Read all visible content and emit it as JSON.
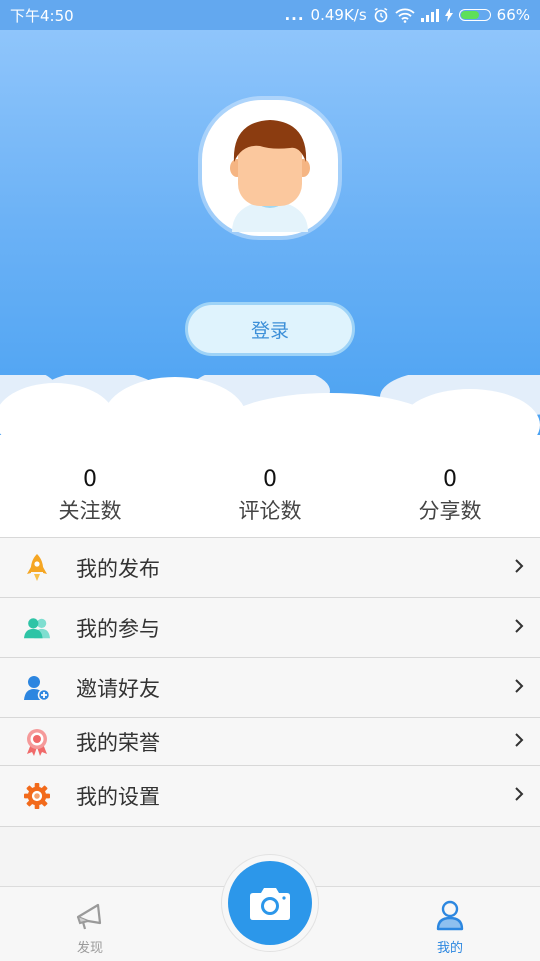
{
  "status_bar": {
    "time": "下午4:50",
    "dots": "...",
    "network_speed": "0.49K/s",
    "battery_percent": "66%",
    "battery_level": 0.66,
    "icons": [
      "alarm-icon",
      "wifi-icon",
      "signal-icon",
      "charging-icon",
      "battery-icon"
    ]
  },
  "profile": {
    "avatar": "avatar-boy",
    "login_label": "登录"
  },
  "stats": [
    {
      "value": "0",
      "label": "关注数"
    },
    {
      "value": "0",
      "label": "评论数"
    },
    {
      "value": "0",
      "label": "分享数"
    }
  ],
  "menu": [
    {
      "label": "我的发布",
      "icon": "rocket-icon",
      "color": "#f5a623"
    },
    {
      "label": "我的参与",
      "icon": "people-icon",
      "color": "#2ec4a6"
    },
    {
      "label": "邀请好友",
      "icon": "add-user-icon",
      "color": "#2d86e0"
    },
    {
      "label": "我的荣誉",
      "icon": "medal-icon",
      "color": "#f06a6a"
    },
    {
      "label": "我的设置",
      "icon": "gear-icon",
      "color": "#f26a1b"
    }
  ],
  "tabbar": {
    "discover_label": "发现",
    "mine_label": "我的",
    "camera_icon": "camera-icon",
    "active_color": "#2c87e0",
    "inactive_color": "#9a9a9a"
  }
}
